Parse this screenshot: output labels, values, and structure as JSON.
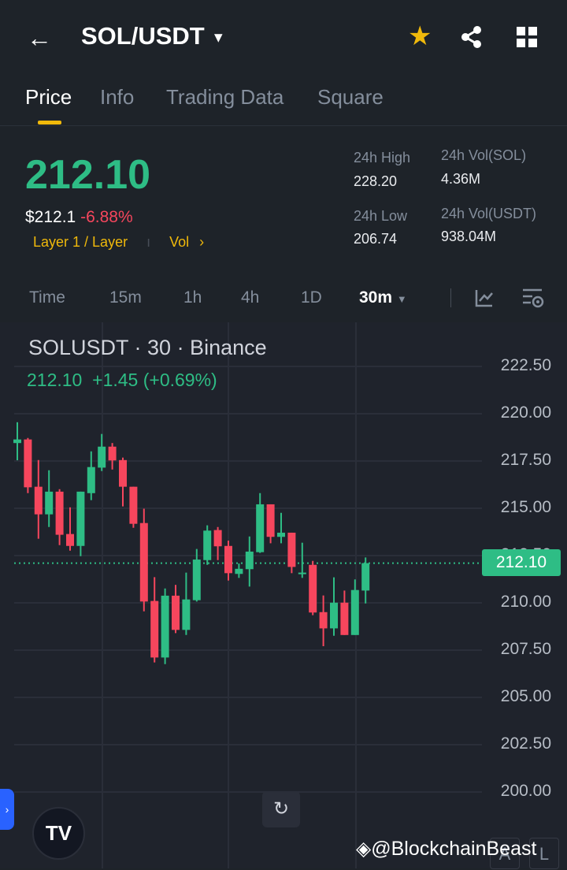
{
  "header": {
    "title": "SOL/USDT"
  },
  "tabs": [
    "Price",
    "Info",
    "Trading Data",
    "Square"
  ],
  "ticker": {
    "last": "212.10",
    "usd": "$212.1",
    "change": "-6.88%",
    "tag": "Layer 1 / Layer",
    "vol_link": "Vol",
    "high_label": "24h High",
    "high": "228.20",
    "low_label": "24h Low",
    "low": "206.74",
    "vol_sol_label": "24h Vol(SOL)",
    "vol_sol": "4.36M",
    "vol_usdt_label": "24h Vol(USDT)",
    "vol_usdt": "938.04M"
  },
  "intervals": [
    "Time",
    "15m",
    "1h",
    "4h",
    "1D"
  ],
  "selected_interval": "30m",
  "chart": {
    "title": "SOLUSDT · 30 · Binance",
    "last": "212.10",
    "chg": "+1.45 (+0.69%)",
    "price_tag": "212.10"
  },
  "watermark": "@BlockchainBeast",
  "axis_buttons": [
    "A",
    "L"
  ],
  "colors": {
    "up": "#2ebd85",
    "down": "#f6465d",
    "accent": "#f0b90b"
  },
  "chart_data": {
    "type": "candlestick",
    "ylim": [
      197.5,
      224
    ],
    "yticks": [
      "222.50",
      "220.00",
      "217.50",
      "215.00",
      "212.50",
      "210.00",
      "207.50",
      "205.00",
      "202.50",
      "200.00"
    ],
    "ohlc": [
      [
        218.45,
        219.55,
        217.54,
        218.64
      ],
      [
        218.64,
        218.72,
        215.8,
        216.11
      ],
      [
        216.14,
        217.55,
        213.39,
        214.68
      ],
      [
        214.68,
        217.01,
        214.01,
        215.88
      ],
      [
        215.88,
        216.01,
        213.05,
        213.6
      ],
      [
        213.64,
        215.05,
        212.76,
        213.01
      ],
      [
        213.01,
        215.88,
        212.47,
        215.88
      ],
      [
        215.8,
        218.01,
        215.43,
        217.18
      ],
      [
        217.15,
        218.93,
        216.97,
        218.26
      ],
      [
        218.26,
        218.45,
        217.05,
        217.53
      ],
      [
        217.55,
        217.68,
        215.1,
        216.14
      ],
      [
        216.14,
        216.14,
        213.97,
        214.18
      ],
      [
        214.22,
        214.98,
        209.55,
        210.07
      ],
      [
        210.1,
        211.36,
        206.85,
        207.11
      ],
      [
        207.11,
        210.76,
        206.76,
        210.38
      ],
      [
        210.38,
        210.95,
        208.4,
        208.57
      ],
      [
        208.57,
        211.6,
        208.3,
        210.18
      ],
      [
        210.14,
        212.85,
        210.07,
        212.29
      ],
      [
        212.26,
        214.1,
        212.01,
        213.82
      ],
      [
        213.85,
        214.01,
        212.26,
        212.99
      ],
      [
        213.01,
        213.29,
        211.18,
        211.57
      ],
      [
        211.53,
        212.08,
        211.32,
        211.8
      ],
      [
        211.78,
        213.51,
        210.86,
        212.71
      ],
      [
        212.68,
        215.8,
        212.64,
        215.21
      ],
      [
        215.21,
        215.21,
        213.15,
        213.49
      ],
      [
        213.49,
        214.76,
        213.15,
        213.71
      ],
      [
        213.71,
        213.71,
        211.57,
        211.9
      ],
      [
        211.55,
        213.18,
        211.32,
        211.6
      ],
      [
        212.01,
        212.22,
        209.35,
        209.49
      ],
      [
        209.51,
        210.39,
        207.71,
        208.65
      ],
      [
        208.65,
        211.35,
        208.26,
        210.01
      ],
      [
        210.01,
        210.65,
        208.3,
        208.3
      ],
      [
        208.3,
        211.24,
        208.3,
        210.68
      ],
      [
        210.65,
        212.4,
        209.97,
        212.1
      ]
    ],
    "last_price": 212.1
  }
}
